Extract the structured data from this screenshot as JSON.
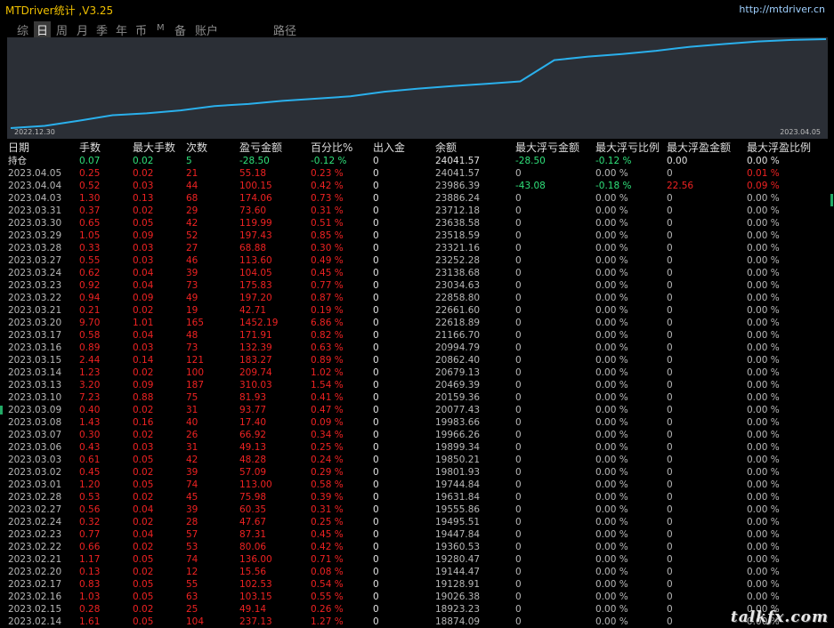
{
  "window": {
    "title": "MTDriver统计 ,V3.25",
    "url": "http://mtdriver.cn"
  },
  "tabs": [
    {
      "label": "综",
      "active": false
    },
    {
      "label": "日",
      "active": true
    },
    {
      "label": "周",
      "active": false
    },
    {
      "label": "月",
      "active": false
    },
    {
      "label": "季",
      "active": false
    },
    {
      "label": "年",
      "active": false
    },
    {
      "label": "币",
      "active": false
    },
    {
      "label": "M",
      "active": false
    },
    {
      "label": "备",
      "active": false
    },
    {
      "label": "账户",
      "active": false
    },
    {
      "label": "路径",
      "active": false
    }
  ],
  "chart": {
    "start_label": "2022.12.30",
    "end_label": "2023.04.05",
    "line_color": "#2ab0ec"
  },
  "chart_data": {
    "type": "line",
    "series": [
      {
        "values": [
          18000,
          18150,
          18500,
          18874,
          19000,
          19200,
          19500,
          19640,
          19850,
          20000,
          20160,
          20470,
          20680,
          20860,
          21000,
          21170,
          22619,
          22860,
          23035,
          23250,
          23520,
          23712,
          23886,
          23986,
          24042
        ]
      }
    ],
    "x_range": [
      "2022.12.30",
      "2023.04.05"
    ],
    "grid": false
  },
  "table": {
    "headers": [
      "日期",
      "手数",
      "最大手数",
      "次数",
      "盈亏金额",
      "百分比%",
      "出入金",
      "余额",
      "最大浮亏金额",
      "最大浮亏比例",
      "最大浮盈金额",
      "最大浮盈比例"
    ],
    "holding": [
      "持仓",
      "0.07",
      "0.02",
      "5",
      "-28.50",
      "-0.12 %",
      "0",
      "24041.57",
      "-28.50",
      "-0.12 %",
      "0.00",
      "0.00 %"
    ],
    "rows": [
      [
        "2023.04.05",
        "0.25",
        "0.02",
        "21",
        "55.18",
        "0.23 %",
        "0",
        "24041.57",
        "0",
        "0.00 %",
        "0",
        "0.01 %"
      ],
      [
        "2023.04.04",
        "0.52",
        "0.03",
        "44",
        "100.15",
        "0.42 %",
        "0",
        "23986.39",
        "-43.08",
        "-0.18 %",
        "22.56",
        "0.09 %"
      ],
      [
        "2023.04.03",
        "1.30",
        "0.13",
        "68",
        "174.06",
        "0.73 %",
        "0",
        "23886.24",
        "0",
        "0.00 %",
        "0",
        "0.00 %"
      ],
      [
        "2023.03.31",
        "0.37",
        "0.02",
        "29",
        "73.60",
        "0.31 %",
        "0",
        "23712.18",
        "0",
        "0.00 %",
        "0",
        "0.00 %"
      ],
      [
        "2023.03.30",
        "0.65",
        "0.05",
        "42",
        "119.99",
        "0.51 %",
        "0",
        "23638.58",
        "0",
        "0.00 %",
        "0",
        "0.00 %"
      ],
      [
        "2023.03.29",
        "1.05",
        "0.09",
        "52",
        "197.43",
        "0.85 %",
        "0",
        "23518.59",
        "0",
        "0.00 %",
        "0",
        "0.00 %"
      ],
      [
        "2023.03.28",
        "0.33",
        "0.03",
        "27",
        "68.88",
        "0.30 %",
        "0",
        "23321.16",
        "0",
        "0.00 %",
        "0",
        "0.00 %"
      ],
      [
        "2023.03.27",
        "0.55",
        "0.03",
        "46",
        "113.60",
        "0.49 %",
        "0",
        "23252.28",
        "0",
        "0.00 %",
        "0",
        "0.00 %"
      ],
      [
        "2023.03.24",
        "0.62",
        "0.04",
        "39",
        "104.05",
        "0.45 %",
        "0",
        "23138.68",
        "0",
        "0.00 %",
        "0",
        "0.00 %"
      ],
      [
        "2023.03.23",
        "0.92",
        "0.04",
        "73",
        "175.83",
        "0.77 %",
        "0",
        "23034.63",
        "0",
        "0.00 %",
        "0",
        "0.00 %"
      ],
      [
        "2023.03.22",
        "0.94",
        "0.09",
        "49",
        "197.20",
        "0.87 %",
        "0",
        "22858.80",
        "0",
        "0.00 %",
        "0",
        "0.00 %"
      ],
      [
        "2023.03.21",
        "0.21",
        "0.02",
        "19",
        "42.71",
        "0.19 %",
        "0",
        "22661.60",
        "0",
        "0.00 %",
        "0",
        "0.00 %"
      ],
      [
        "2023.03.20",
        "9.70",
        "1.01",
        "165",
        "1452.19",
        "6.86 %",
        "0",
        "22618.89",
        "0",
        "0.00 %",
        "0",
        "0.00 %"
      ],
      [
        "2023.03.17",
        "0.58",
        "0.04",
        "48",
        "171.91",
        "0.82 %",
        "0",
        "21166.70",
        "0",
        "0.00 %",
        "0",
        "0.00 %"
      ],
      [
        "2023.03.16",
        "0.89",
        "0.03",
        "73",
        "132.39",
        "0.63 %",
        "0",
        "20994.79",
        "0",
        "0.00 %",
        "0",
        "0.00 %"
      ],
      [
        "2023.03.15",
        "2.44",
        "0.14",
        "121",
        "183.27",
        "0.89 %",
        "0",
        "20862.40",
        "0",
        "0.00 %",
        "0",
        "0.00 %"
      ],
      [
        "2023.03.14",
        "1.23",
        "0.02",
        "100",
        "209.74",
        "1.02 %",
        "0",
        "20679.13",
        "0",
        "0.00 %",
        "0",
        "0.00 %"
      ],
      [
        "2023.03.13",
        "3.20",
        "0.09",
        "187",
        "310.03",
        "1.54 %",
        "0",
        "20469.39",
        "0",
        "0.00 %",
        "0",
        "0.00 %"
      ],
      [
        "2023.03.10",
        "7.23",
        "0.88",
        "75",
        "81.93",
        "0.41 %",
        "0",
        "20159.36",
        "0",
        "0.00 %",
        "0",
        "0.00 %"
      ],
      [
        "2023.03.09",
        "0.40",
        "0.02",
        "31",
        "93.77",
        "0.47 %",
        "0",
        "20077.43",
        "0",
        "0.00 %",
        "0",
        "0.00 %"
      ],
      [
        "2023.03.08",
        "1.43",
        "0.16",
        "40",
        "17.40",
        "0.09 %",
        "0",
        "19983.66",
        "0",
        "0.00 %",
        "0",
        "0.00 %"
      ],
      [
        "2023.03.07",
        "0.30",
        "0.02",
        "26",
        "66.92",
        "0.34 %",
        "0",
        "19966.26",
        "0",
        "0.00 %",
        "0",
        "0.00 %"
      ],
      [
        "2023.03.06",
        "0.43",
        "0.03",
        "31",
        "49.13",
        "0.25 %",
        "0",
        "19899.34",
        "0",
        "0.00 %",
        "0",
        "0.00 %"
      ],
      [
        "2023.03.03",
        "0.61",
        "0.05",
        "42",
        "48.28",
        "0.24 %",
        "0",
        "19850.21",
        "0",
        "0.00 %",
        "0",
        "0.00 %"
      ],
      [
        "2023.03.02",
        "0.45",
        "0.02",
        "39",
        "57.09",
        "0.29 %",
        "0",
        "19801.93",
        "0",
        "0.00 %",
        "0",
        "0.00 %"
      ],
      [
        "2023.03.01",
        "1.20",
        "0.05",
        "74",
        "113.00",
        "0.58 %",
        "0",
        "19744.84",
        "0",
        "0.00 %",
        "0",
        "0.00 %"
      ],
      [
        "2023.02.28",
        "0.53",
        "0.02",
        "45",
        "75.98",
        "0.39 %",
        "0",
        "19631.84",
        "0",
        "0.00 %",
        "0",
        "0.00 %"
      ],
      [
        "2023.02.27",
        "0.56",
        "0.04",
        "39",
        "60.35",
        "0.31 %",
        "0",
        "19555.86",
        "0",
        "0.00 %",
        "0",
        "0.00 %"
      ],
      [
        "2023.02.24",
        "0.32",
        "0.02",
        "28",
        "47.67",
        "0.25 %",
        "0",
        "19495.51",
        "0",
        "0.00 %",
        "0",
        "0.00 %"
      ],
      [
        "2023.02.23",
        "0.77",
        "0.04",
        "57",
        "87.31",
        "0.45 %",
        "0",
        "19447.84",
        "0",
        "0.00 %",
        "0",
        "0.00 %"
      ],
      [
        "2023.02.22",
        "0.66",
        "0.02",
        "53",
        "80.06",
        "0.42 %",
        "0",
        "19360.53",
        "0",
        "0.00 %",
        "0",
        "0.00 %"
      ],
      [
        "2023.02.21",
        "1.17",
        "0.05",
        "74",
        "136.00",
        "0.71 %",
        "0",
        "19280.47",
        "0",
        "0.00 %",
        "0",
        "0.00 %"
      ],
      [
        "2023.02.20",
        "0.13",
        "0.02",
        "12",
        "15.56",
        "0.08 %",
        "0",
        "19144.47",
        "0",
        "0.00 %",
        "0",
        "0.00 %"
      ],
      [
        "2023.02.17",
        "0.83",
        "0.05",
        "55",
        "102.53",
        "0.54 %",
        "0",
        "19128.91",
        "0",
        "0.00 %",
        "0",
        "0.00 %"
      ],
      [
        "2023.02.16",
        "1.03",
        "0.05",
        "63",
        "103.15",
        "0.55 %",
        "0",
        "19026.38",
        "0",
        "0.00 %",
        "0",
        "0.00 %"
      ],
      [
        "2023.02.15",
        "0.28",
        "0.02",
        "25",
        "49.14",
        "0.26 %",
        "0",
        "18923.23",
        "0",
        "0.00 %",
        "0",
        "0.00 %"
      ],
      [
        "2023.02.14",
        "1.61",
        "0.05",
        "104",
        "237.13",
        "1.27 %",
        "0",
        "18874.09",
        "0",
        "0.00 %",
        "0",
        "0.00 %"
      ]
    ]
  },
  "watermark": "talkfx.com",
  "colors": {
    "positive": "#e22222",
    "negative": "#2fe07a",
    "neutral": "#b8b8b8",
    "title": "#f0c000"
  }
}
